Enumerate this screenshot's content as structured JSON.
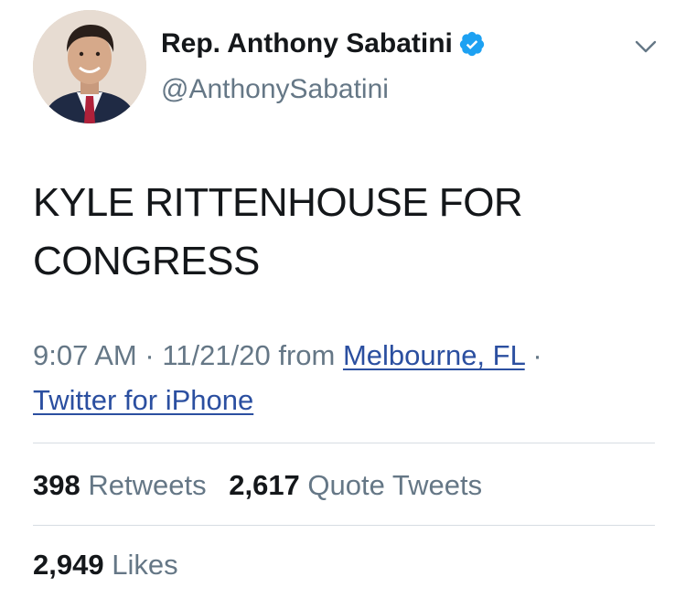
{
  "tweet": {
    "author": {
      "display_name": "Rep. Anthony Sabatini",
      "handle": "@AnthonySabatini",
      "verified": true,
      "avatar_icon": "profile-photo"
    },
    "text": "KYLE RITTENHOUSE FOR CONGRESS",
    "time": "9:07 AM",
    "separator": "·",
    "date": "11/21/20",
    "from_label": "from",
    "location": "Melbourne, FL",
    "source": "Twitter for iPhone",
    "stats": {
      "retweets_count": "398",
      "retweets_label": "Retweets",
      "quote_count": "2,617",
      "quote_label": "Quote Tweets",
      "likes_count": "2,949",
      "likes_label": "Likes"
    }
  },
  "colors": {
    "text_primary": "#14171a",
    "text_secondary": "#657786",
    "link": "#2b4fa0",
    "verified_badge": "#1da1f2",
    "divider": "#d7dde2"
  },
  "icons": {
    "verified": "verified-badge-icon",
    "menu": "chevron-down-icon"
  }
}
